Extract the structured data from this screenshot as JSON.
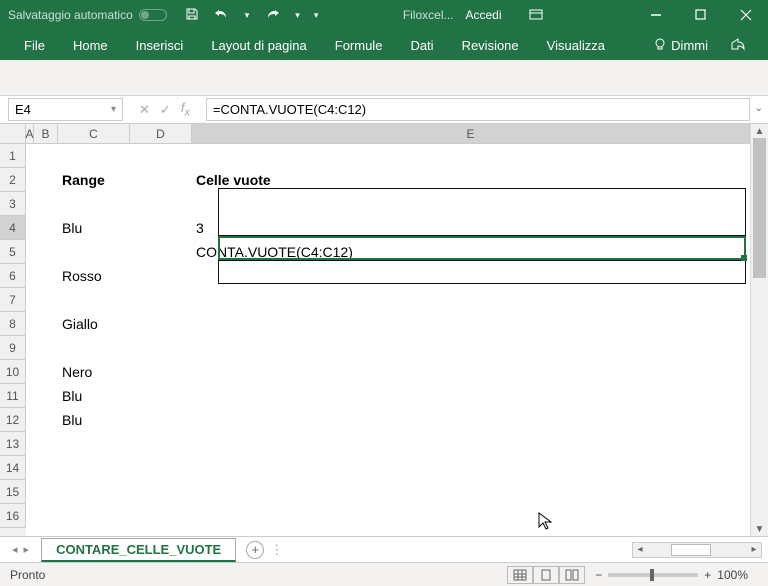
{
  "titlebar": {
    "autosave": "Salvataggio automatico",
    "filename": "Filoxcel...",
    "signin": "Accedi"
  },
  "ribbon": {
    "tabs": [
      "File",
      "Home",
      "Inserisci",
      "Layout di pagina",
      "Formule",
      "Dati",
      "Revisione",
      "Visualizza"
    ],
    "tell_me": "Dimmi"
  },
  "formulabar": {
    "cellref": "E4",
    "formula": "=CONTA.VUOTE(C4:C12)"
  },
  "columns": [
    "A",
    "B",
    "C",
    "D",
    "E"
  ],
  "rows": [
    "1",
    "2",
    "3",
    "4",
    "5",
    "6",
    "7",
    "8",
    "9",
    "10",
    "11",
    "12",
    "13",
    "14",
    "15",
    "16"
  ],
  "selected_row": "4",
  "selected_col": "E",
  "cells": {
    "C2": "Range",
    "E2": "Celle vuote",
    "C4": "Blu",
    "E4": "3",
    "E5": "CONTA.VUOTE(C4:C12)",
    "C6": "Rosso",
    "C8": "Giallo",
    "C10": "Nero",
    "C11": "Blu",
    "C12": "Blu"
  },
  "sheet": {
    "name": "CONTARE_CELLE_VUOTE"
  },
  "statusbar": {
    "ready": "Pronto",
    "zoom": "100%"
  }
}
